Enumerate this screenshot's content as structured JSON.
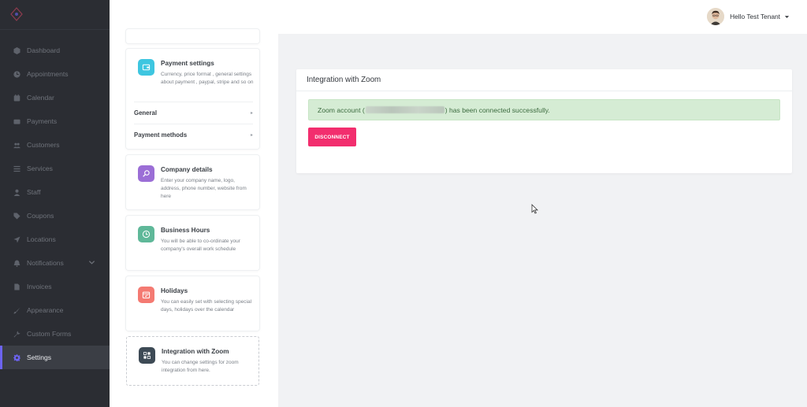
{
  "sidebar": {
    "items": [
      {
        "label": "Dashboard",
        "icon": "dashboard-icon"
      },
      {
        "label": "Appointments",
        "icon": "clock-icon"
      },
      {
        "label": "Calendar",
        "icon": "calendar-icon"
      },
      {
        "label": "Payments",
        "icon": "payments-icon"
      },
      {
        "label": "Customers",
        "icon": "users-icon"
      },
      {
        "label": "Services",
        "icon": "list-icon"
      },
      {
        "label": "Staff",
        "icon": "user-icon"
      },
      {
        "label": "Coupons",
        "icon": "tag-icon"
      },
      {
        "label": "Locations",
        "icon": "location-arrow-icon"
      },
      {
        "label": "Notifications",
        "icon": "bell-icon"
      },
      {
        "label": "Invoices",
        "icon": "file-icon"
      },
      {
        "label": "Appearance",
        "icon": "brush-icon"
      },
      {
        "label": "Custom Forms",
        "icon": "wrench-icon"
      },
      {
        "label": "Settings",
        "icon": "gear-icon"
      }
    ],
    "active": "Settings"
  },
  "header": {
    "greeting": "Hello Test Tenant"
  },
  "settings": {
    "payment": {
      "title": "Payment settings",
      "description": "Currency, price format , general settings about payment , paypal, stripe and so on",
      "sub_general": "General",
      "sub_methods": "Payment methods",
      "arrow": "▸"
    },
    "company": {
      "title": "Company details",
      "description": "Enter your company name, logo, address, phone number, website from here"
    },
    "hours": {
      "title": "Business Hours",
      "description": "You will be able to co-ordinate your company's overall work schedule"
    },
    "holidays": {
      "title": "Holidays",
      "description": "You can easily set with selecting special days, holidays over the calendar"
    },
    "zoom": {
      "title": "Integration with Zoom",
      "description": "You can change settings for zoom integration from here."
    }
  },
  "main": {
    "title": "Integration with Zoom",
    "alert_prefix": "Zoom account (",
    "alert_suffix": ") has been connected successfully.",
    "disconnect_label": "DISCONNECT"
  },
  "colors": {
    "accent": "#6c63f0",
    "disconnect": "#f22e6e",
    "success_bg": "#d5ecd4",
    "payment_badge": "#3ec6e0",
    "company_badge": "#9b6ed6",
    "hours_badge": "#5fb899",
    "holidays_badge": "#f47a72",
    "zoom_badge": "#3d4a55"
  }
}
